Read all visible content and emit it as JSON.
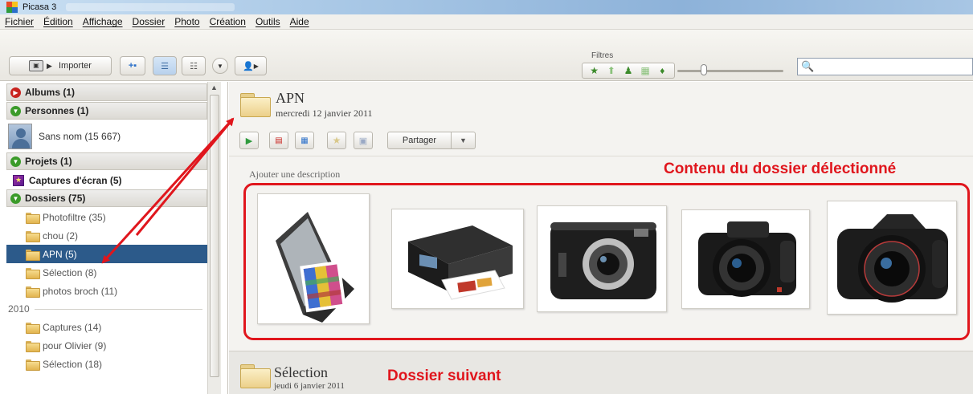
{
  "window": {
    "title": "Picasa 3"
  },
  "menu": [
    "Fichier",
    "Édition",
    "Affichage",
    "Dossier",
    "Photo",
    "Création",
    "Outils",
    "Aide"
  ],
  "toolbar": {
    "import_label": "Importer",
    "filters_label": "Filtres"
  },
  "sidebar": {
    "albums": "Albums (1)",
    "persons": "Personnes (1)",
    "person_unnamed": "Sans nom (15 667)",
    "projects": "Projets (1)",
    "project_item": "Captures d'écran (5)",
    "folders": "Dossiers (75)",
    "folder_items": [
      "Photofiltre (35)",
      "chou (2)",
      "APN (5)",
      "Sélection (8)",
      "photos broch (11)"
    ],
    "year": "2010",
    "year_items": [
      "Captures (14)",
      "pour Olivier (9)",
      "Sélection (18)"
    ]
  },
  "main": {
    "folder_name": "APN",
    "folder_date": "mercredi 12 janvier 2011",
    "share_label": "Partager",
    "description_placeholder": "Ajouter une description",
    "annotation_content": "Contenu du dossier délectionné",
    "next_folder_name": "Sélection",
    "next_folder_date": "jeudi 6 janvier 2011",
    "annotation_next": "Dossier suivant"
  },
  "thumbnails": [
    "scanner",
    "printer",
    "compact-camera",
    "bridge-camera",
    "dslr-camera"
  ],
  "colors": {
    "annotation_red": "#e0161d",
    "selected_bg": "#2c5a8a",
    "title_bar": "#a9c8e6"
  }
}
